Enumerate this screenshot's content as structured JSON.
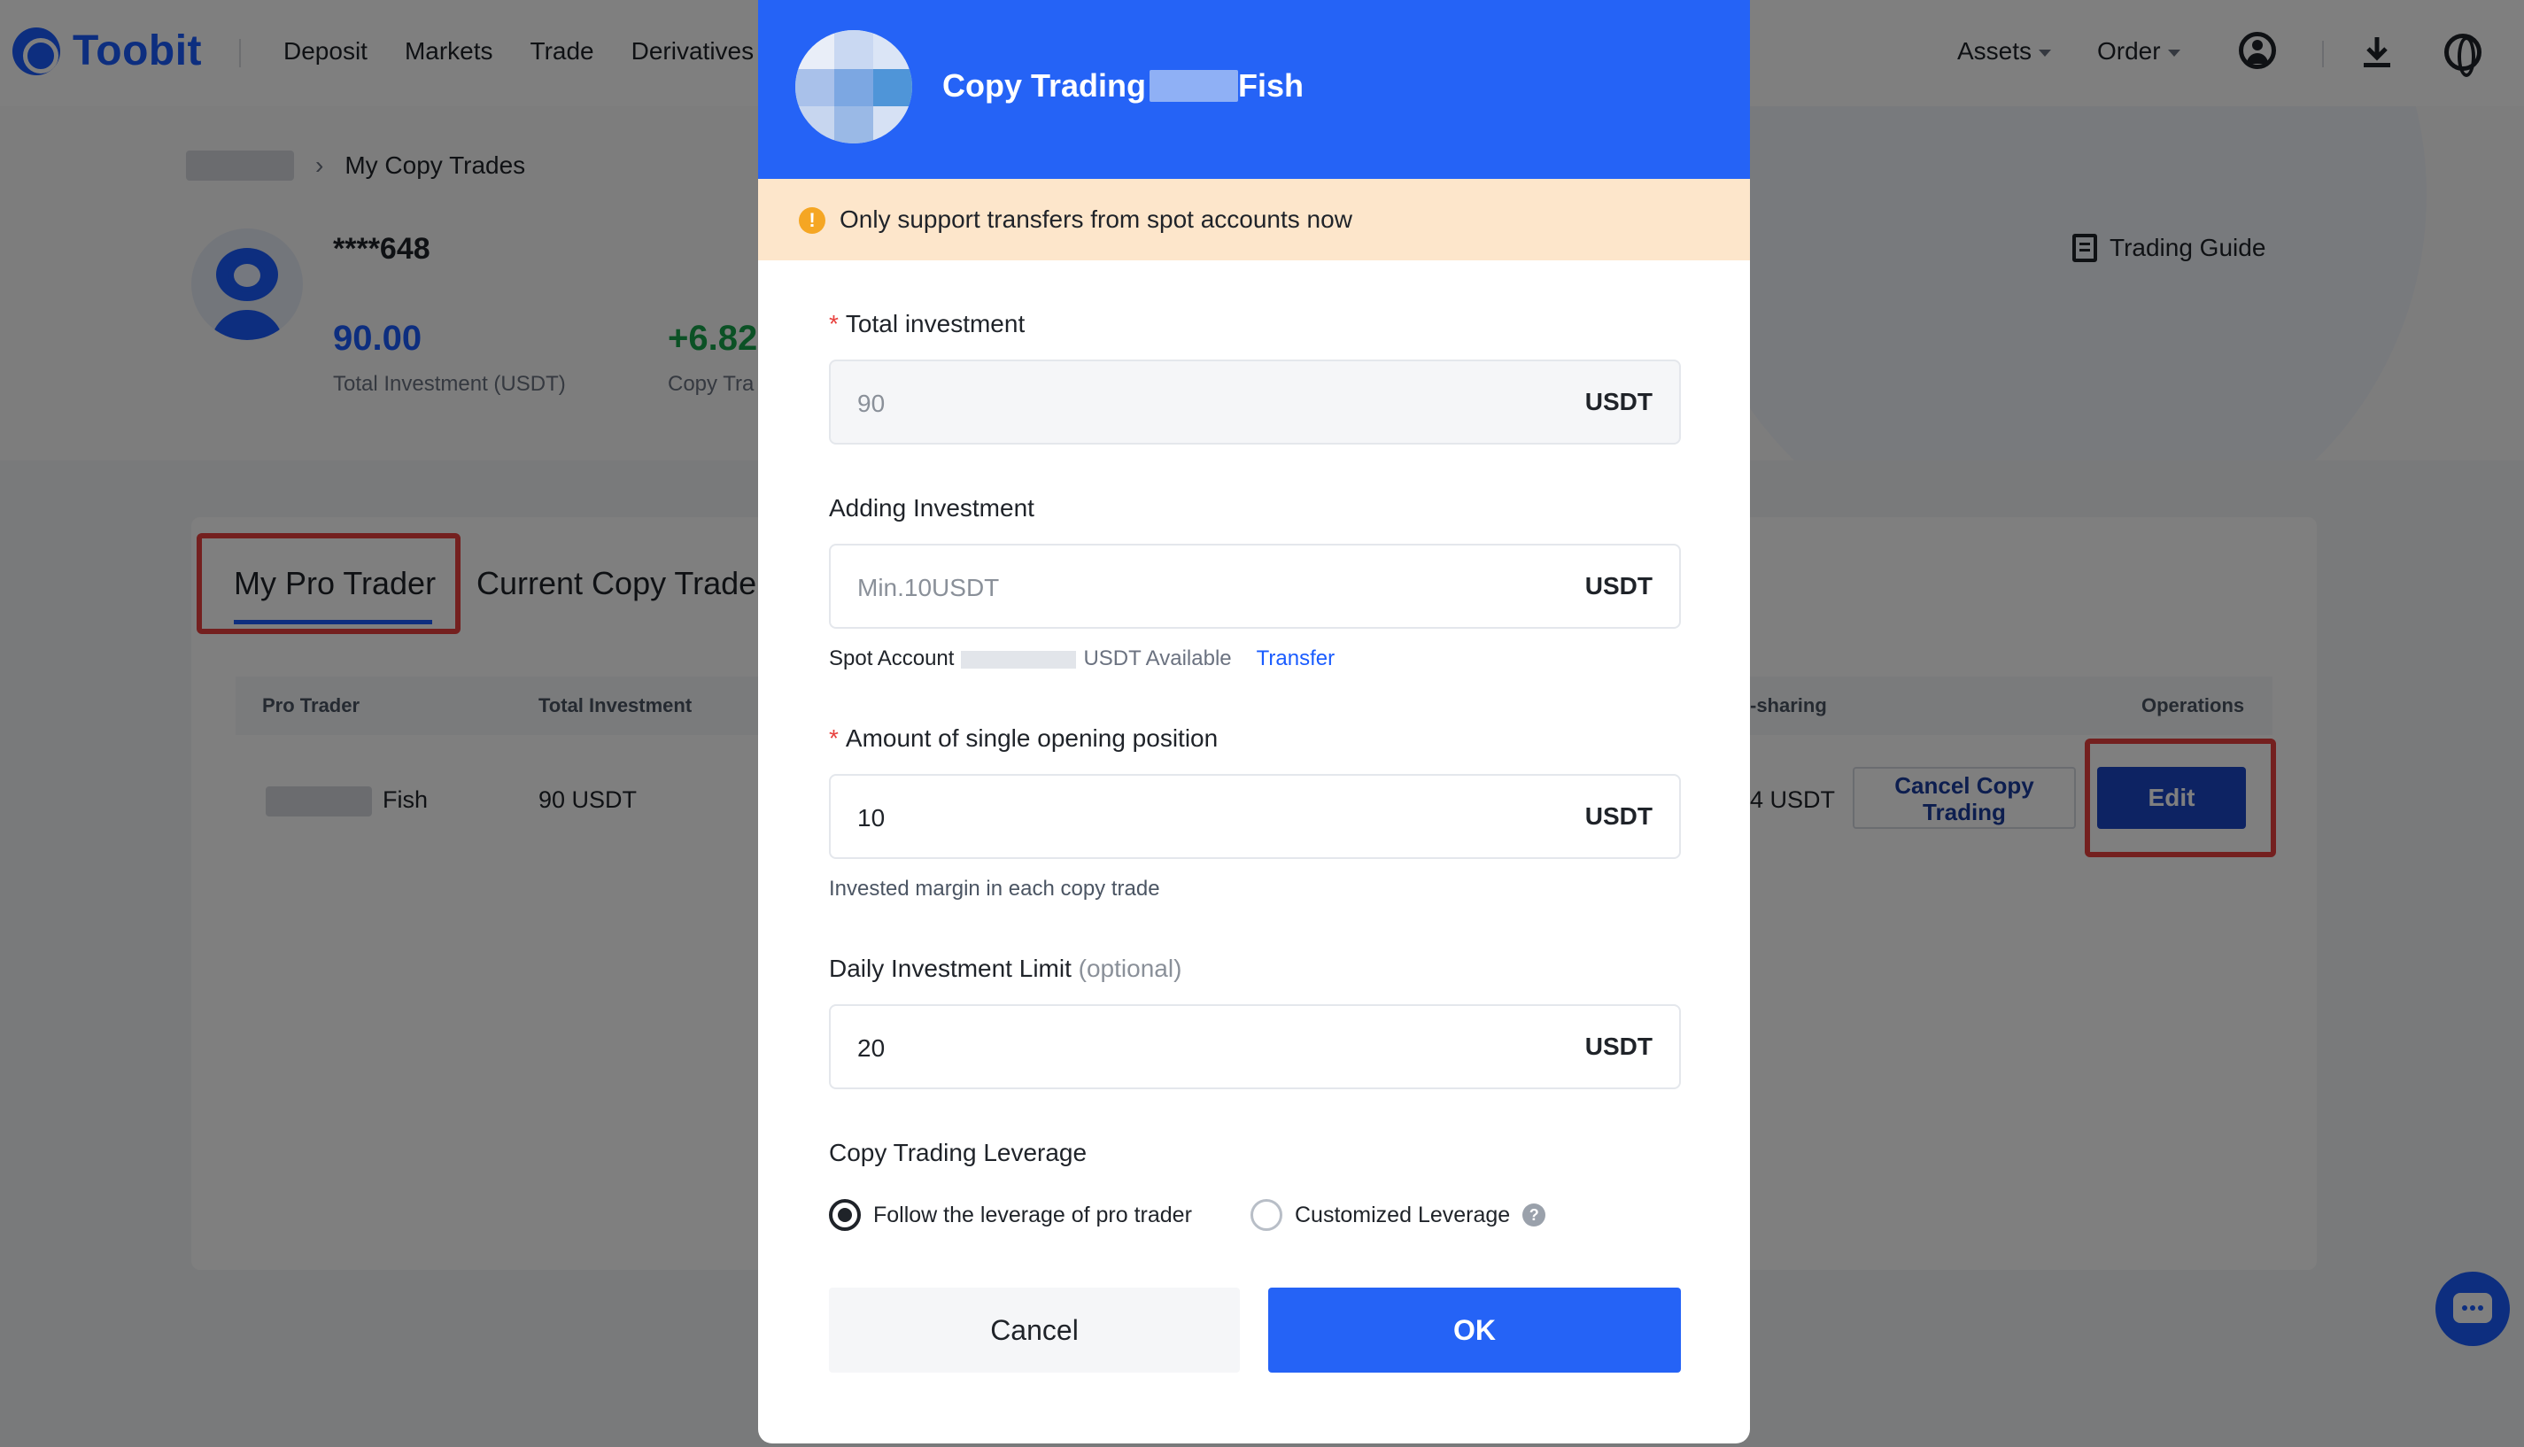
{
  "nav": {
    "logo": "Toobit",
    "links": [
      "Deposit",
      "Markets",
      "Trade",
      "Derivatives"
    ],
    "assets": "Assets",
    "order": "Order"
  },
  "breadcrumb": {
    "current": "My Copy Trades"
  },
  "profile": {
    "name": "****648",
    "stat1_value": "90.00",
    "stat1_label": "Total Investment (USDT)",
    "stat2_value": "+6.82",
    "stat2_label": "Copy Tra",
    "guide": "Trading Guide"
  },
  "tabs": [
    "My Pro Trader",
    "Current Copy Trade"
  ],
  "table": {
    "headers": [
      "Pro Trader",
      "Total Investment",
      "-sharing",
      "Operations"
    ],
    "row": {
      "trader": "Fish",
      "investment": "90 USDT",
      "profit_sharing": "4 USDT",
      "cancel_label": "Cancel Copy Trading",
      "edit_label": "Edit"
    }
  },
  "modal": {
    "title_prefix": "Copy Trading",
    "title_suffix": "Fish",
    "warning": "Only support transfers from spot accounts now",
    "total_investment": {
      "label": "Total investment",
      "value": "90",
      "unit": "USDT"
    },
    "adding_investment": {
      "label": "Adding Investment",
      "placeholder": "Min.10USDT",
      "unit": "USDT"
    },
    "spot": {
      "label": "Spot Account",
      "available": "USDT Available",
      "transfer": "Transfer"
    },
    "single_position": {
      "label": "Amount of single opening position",
      "value": "10",
      "unit": "USDT",
      "hint": "Invested margin in each copy trade"
    },
    "daily_limit": {
      "label": "Daily Investment Limit",
      "optional": "(optional)",
      "value": "20",
      "unit": "USDT"
    },
    "leverage": {
      "label": "Copy Trading Leverage",
      "option_follow": "Follow the leverage of pro trader",
      "option_custom": "Customized Leverage",
      "help": "?"
    },
    "cancel": "Cancel",
    "ok": "OK"
  },
  "colors": {
    "brand": "#2563f6",
    "warning_bg": "#fde6cb",
    "highlight": "#e8413e"
  }
}
